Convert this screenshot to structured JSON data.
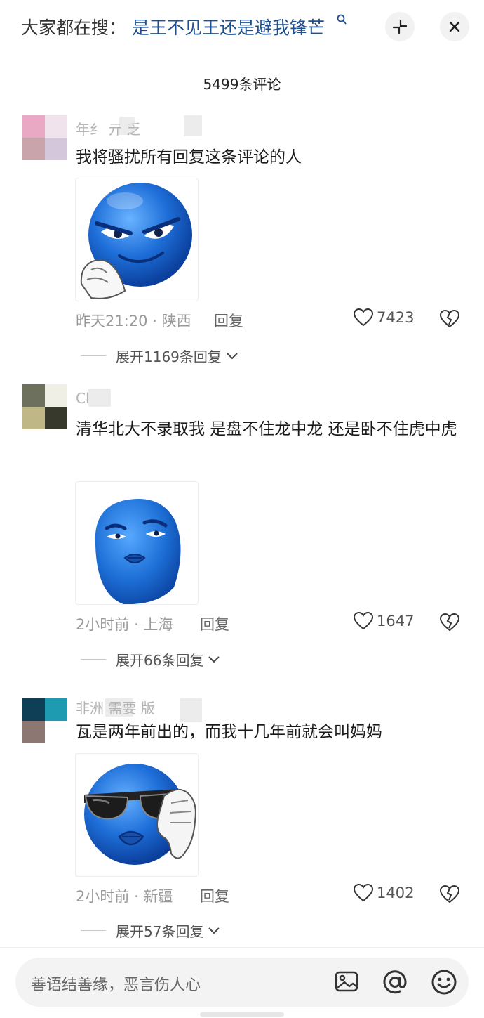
{
  "top": {
    "search_prefix": "大家都在搜：",
    "search_term": "是王不见王还是避我锋芒",
    "search_icon": "magnifier-icon",
    "expand_icon": "expand-arrows-icon",
    "close_icon": "close-icon"
  },
  "comment_count": "5499条评论",
  "comments": [
    {
      "username": "年纟 亓 乏",
      "avatar_colors": [
        "#e9a9c4",
        "#f1e3ec",
        "#c9a4ab",
        "#d4c6db"
      ],
      "text": "我将骚扰所有回复这条评论的人",
      "sticker": "blue-smiley-scheming",
      "time": "昨天21:20",
      "location": "陕西",
      "reply_label": "回复",
      "likes": "7423",
      "expand_label": "展开1169条回复"
    },
    {
      "username": "Cl",
      "avatar_colors": [
        "#6e705e",
        "#f0efe6",
        "#bfb886",
        "#37392c"
      ],
      "text": "清华北大不录取我 是盘不住龙中龙 还是卧不住虎中虎",
      "sticker": "blue-face-smug",
      "time": "2小时前",
      "location": "上海",
      "reply_label": "回复",
      "likes": "1647",
      "expand_label": "展开66条回复"
    },
    {
      "username": "非洲 需要 版",
      "avatar_colors": [
        "#0f3e57",
        "#1e9bb0",
        "#8d7773",
        "#ffffff"
      ],
      "text": "瓦是两年前出的，而我十几年前就会叫妈妈",
      "sticker": "blue-smiley-sunglasses-thumbs-down",
      "time": "2小时前",
      "location": "新疆",
      "reply_label": "回复",
      "likes": "1402",
      "expand_label": "展开57条回复"
    }
  ],
  "bottom": {
    "placeholder": "善语结善缘，恶言伤人心",
    "image_icon": "image-icon",
    "at_icon": "at-icon",
    "emoji_icon": "emoji-icon"
  },
  "colors": {
    "link_blue": "#1f4e8c",
    "sticker_blue": "#1e6fd9"
  }
}
